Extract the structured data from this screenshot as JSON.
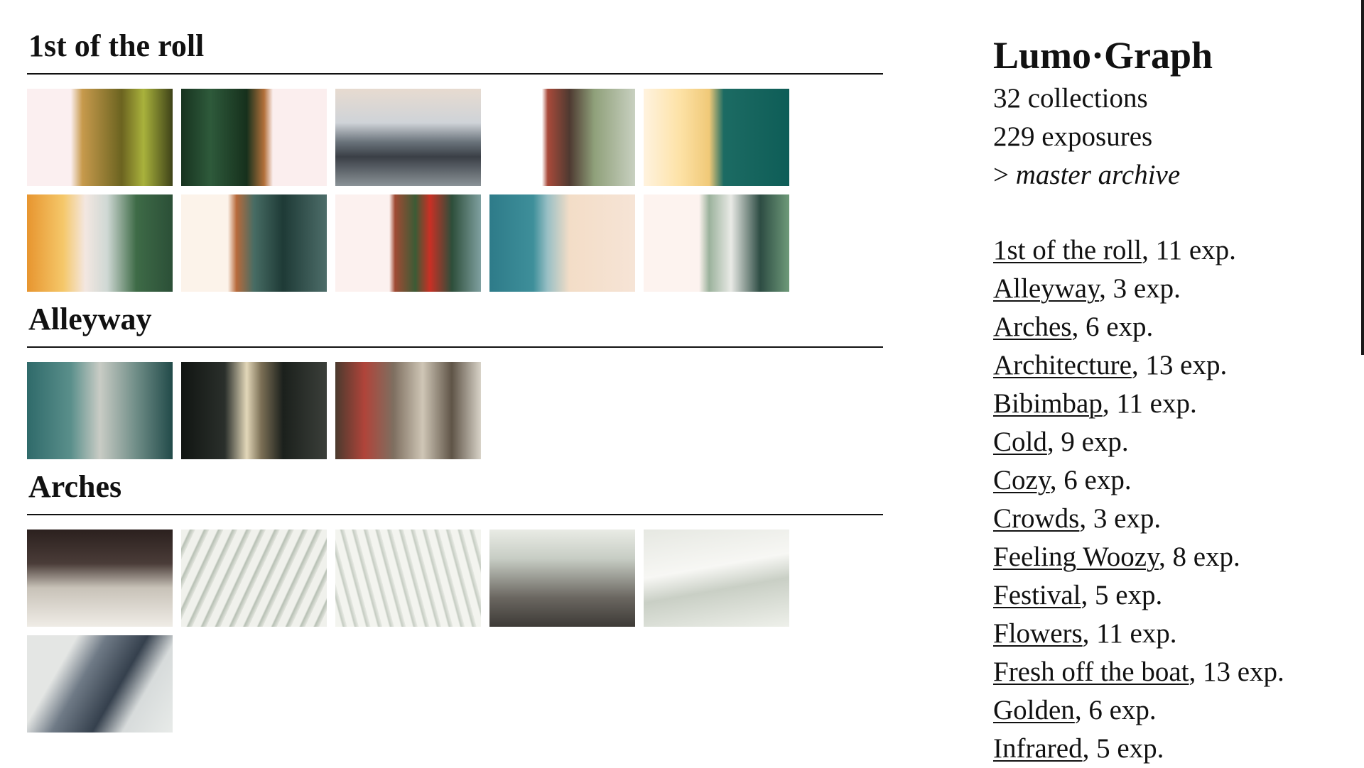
{
  "sections": [
    {
      "title": "1st of the roll",
      "thumbs": [
        {
          "name": "photo-portrait-man-smiling",
          "bg": "linear-gradient(90deg,#fbeff0 0%,#fbeff0 30%,#c79a4c 38%,#6b6320 65%,#a9b23c 80%,#3e4218 100%)"
        },
        {
          "name": "photo-dark-foliage",
          "bg": "linear-gradient(90deg,#17331f 0%,#2e5a3b 20%,#16301c 45%,#b3703a 57%,#fbeeee 63%,#fbeeee 100%)"
        },
        {
          "name": "photo-river-pilings",
          "bg": "linear-gradient(180deg,#e7dbd0 0%,#cfd3d8 35%,#69727a 55%,#3a3f46 70%,#8a9297 100%)"
        },
        {
          "name": "photo-man-in-park",
          "bg": "linear-gradient(90deg,#ffffff 0%,#ffffff 36%,#a94a3a 40%,#4e3a31 55%,#8fa07a 72%,#c8d0c0 100%)"
        },
        {
          "name": "photo-teal-window",
          "bg": "linear-gradient(90deg,#fff3df 0%,#fde2a6 25%,#f0c978 45%,#1c6b63 55%,#0e5d57 100%)"
        },
        {
          "name": "photo-lotus-pond-tower",
          "bg": "linear-gradient(90deg,#e7952f 0%,#f5c86a 25%,#f3e7e1 40%,#cfd8d4 55%,#3e6b47 75%,#2b4f37 100%)"
        },
        {
          "name": "photo-station-hall",
          "bg": "linear-gradient(90deg,#fcf3ea 0%,#fcf3ea 32%,#b86a3b 38%,#476c64 50%,#1e3a36 70%,#4d6d69 100%)"
        },
        {
          "name": "photo-red-jackets-tree",
          "bg": "linear-gradient(90deg,#fcf1ef 0%,#fcf1ef 37%,#a04a34 41%,#3c5b35 55%,#c93025 65%,#2d4e3a 80%,#7fa0a0 100%)"
        },
        {
          "name": "photo-blue-water-haze",
          "bg": "linear-gradient(90deg,#2e7b89 0%,#3e8f9a 30%,#9ac0c5 40%,#f3ddc7 55%,#f6e4d6 100%)"
        },
        {
          "name": "photo-castle-tower",
          "bg": "linear-gradient(90deg,#fdf3ef 0%,#fdf3ef 38%,#9bb29c 45%,#e9eae6 60%,#2d4c43 80%,#6e9a79 100%)"
        }
      ]
    },
    {
      "title": "Alleyway",
      "thumbs": [
        {
          "name": "photo-covered-arcade",
          "bg": "linear-gradient(90deg,#2f6a6a 0%,#5a8f8b 30%,#c9ccc5 50%,#6f8d87 75%,#214a49 100%)"
        },
        {
          "name": "photo-shuttered-alley",
          "bg": "linear-gradient(90deg,#111512 0%,#2a2f2b 30%,#e2d7b9 45%,#7b6f55 55%,#1b201c 70%,#3b3f3a 100%)"
        },
        {
          "name": "photo-street-awnings",
          "bg": "linear-gradient(90deg,#4b3a2e 0%,#b0443a 20%,#7e6f60 40%,#cfc6b6 60%,#5f5447 80%,#d8d3c8 100%)"
        }
      ]
    },
    {
      "title": "Arches",
      "thumbs": [
        {
          "name": "photo-memorial-pool",
          "bg": "linear-gradient(180deg,#2b201e 0%,#4a3c38 35%,#c8c2b8 60%,#efece6 100%)"
        },
        {
          "name": "photo-oculus-ribs",
          "bg": "repeating-linear-gradient(115deg,#f0f1ec 0px,#f0f1ec 10px,#b7c0b4 12px,#e4e6df 18px)"
        },
        {
          "name": "photo-white-ribs",
          "bg": "repeating-linear-gradient(75deg,#f3f4ef 0px,#f3f4ef 9px,#c5ccc2 11px,#e9ebe5 16px)"
        },
        {
          "name": "photo-ceiling-arches",
          "bg": "linear-gradient(180deg,#e9ebe5 0%,#c7cdc4 30%,#6b6761 70%,#3d3a36 100%)"
        },
        {
          "name": "photo-wing-curve",
          "bg": "linear-gradient(170deg,#e6e8e2 0%,#f7f7f4 40%,#c9cfc5 60%,#eef0ea 100%)"
        },
        {
          "name": "photo-tower-upward",
          "bg": "linear-gradient(120deg,#e4e6e4 0%,#e4e6e4 25%,#6f7a86 40%,#35404d 60%,#d7dbdb 75%,#e8ebe9 100%)"
        }
      ]
    }
  ],
  "sidebar": {
    "brand": "Lumo·Graph",
    "collections_count": "32 collections",
    "exposures_count": "229 exposures",
    "master_prefix": "> ",
    "master_link": "master archive",
    "collections": [
      {
        "name": "1st of the roll",
        "suffix": ", 11 exp."
      },
      {
        "name": "Alleyway",
        "suffix": ", 3 exp."
      },
      {
        "name": "Arches",
        "suffix": ", 6 exp."
      },
      {
        "name": "Architecture",
        "suffix": ", 13 exp."
      },
      {
        "name": "Bibimbap",
        "suffix": ", 11 exp."
      },
      {
        "name": "Cold",
        "suffix": ", 9 exp."
      },
      {
        "name": "Cozy",
        "suffix": ", 6 exp."
      },
      {
        "name": "Crowds",
        "suffix": ", 3 exp."
      },
      {
        "name": "Feeling Woozy",
        "suffix": ", 8 exp."
      },
      {
        "name": "Festival",
        "suffix": ", 5 exp."
      },
      {
        "name": "Flowers",
        "suffix": ", 11 exp."
      },
      {
        "name": "Fresh off the boat",
        "suffix": ", 13 exp."
      },
      {
        "name": "Golden",
        "suffix": ", 6 exp."
      },
      {
        "name": "Infrared",
        "suffix": ", 5 exp."
      }
    ]
  }
}
